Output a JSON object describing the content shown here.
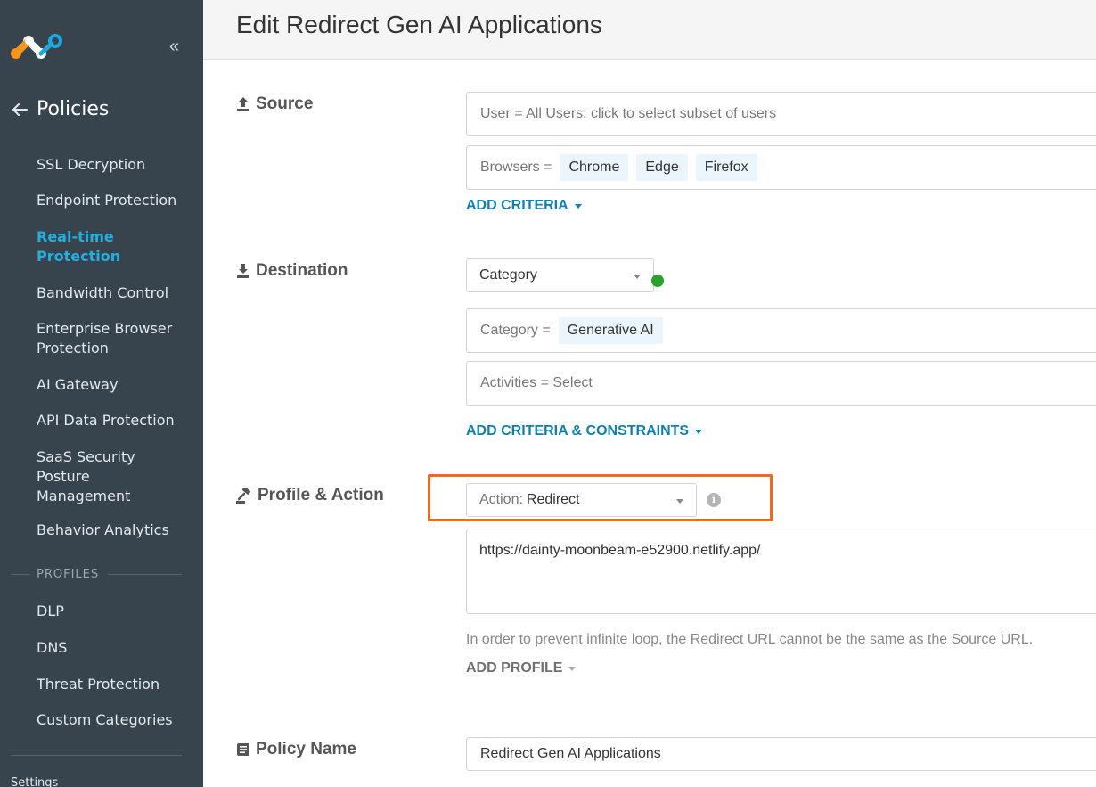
{
  "sidebar": {
    "section_title": "Policies",
    "items": [
      {
        "label": "SSL Decryption",
        "active": false
      },
      {
        "label": "Endpoint Protection",
        "active": false
      },
      {
        "label": "Real-time Protection",
        "active": true
      },
      {
        "label": "Bandwidth Control",
        "active": false
      },
      {
        "label": "Enterprise Browser Protection",
        "active": false
      },
      {
        "label": "AI Gateway",
        "active": false
      },
      {
        "label": "API Data Protection",
        "active": false
      },
      {
        "label": "SaaS Security Posture Management",
        "active": false
      },
      {
        "label": "Behavior Analytics",
        "active": false
      }
    ],
    "profiles_label": "PROFILES",
    "profile_items": [
      {
        "label": "DLP"
      },
      {
        "label": "DNS"
      },
      {
        "label": "Threat Protection"
      },
      {
        "label": "Custom Categories"
      }
    ],
    "settings_label": "Settings"
  },
  "header": {
    "title": "Edit Redirect Gen AI Applications"
  },
  "source": {
    "label": "Source",
    "user_field": "User = All Users: click to select subset of users",
    "browsers_label": "Browsers =",
    "browsers": [
      "Chrome",
      "Edge",
      "Firefox"
    ],
    "add_criteria": "ADD CRITERIA"
  },
  "destination": {
    "label": "Destination",
    "type_select": "Category",
    "category_label": "Category =",
    "categories": [
      "Generative AI"
    ],
    "activities_field": "Activities = Select",
    "add_criteria": "ADD CRITERIA & CONSTRAINTS"
  },
  "profile_action": {
    "label": "Profile & Action",
    "action_prefix": "Action:",
    "action_value": "Redirect",
    "redirect_url": "https://dainty-moonbeam-e52900.netlify.app/",
    "hint": "In order to prevent infinite loop, the Redirect URL cannot be the same as the Source URL.",
    "add_profile": "ADD PROFILE"
  },
  "policy_name": {
    "label": "Policy Name",
    "value": "Redirect Gen AI Applications"
  },
  "colors": {
    "sidebar_bg": "#37434d",
    "active_nav": "#23b0e0",
    "link": "#117fae",
    "highlight": "#f06a1f",
    "status_dot": "#2ea02e",
    "logo_orange": "#f7941d",
    "logo_blue": "#1fa8e0"
  }
}
